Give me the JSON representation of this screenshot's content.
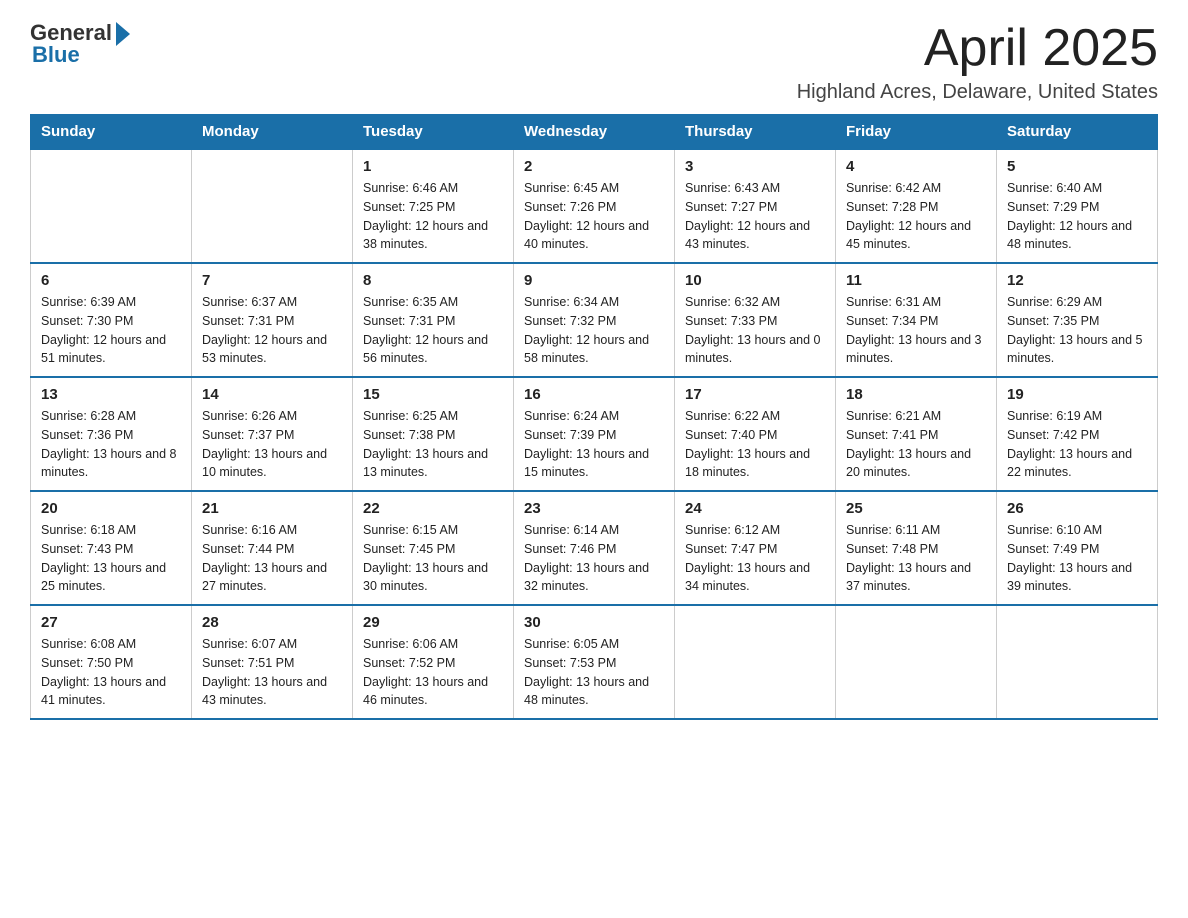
{
  "header": {
    "logo_general": "General",
    "logo_blue": "Blue",
    "month_title": "April 2025",
    "location": "Highland Acres, Delaware, United States"
  },
  "days_of_week": [
    "Sunday",
    "Monday",
    "Tuesday",
    "Wednesday",
    "Thursday",
    "Friday",
    "Saturday"
  ],
  "weeks": [
    [
      {
        "day": "",
        "info": ""
      },
      {
        "day": "",
        "info": ""
      },
      {
        "day": "1",
        "info": "Sunrise: 6:46 AM\nSunset: 7:25 PM\nDaylight: 12 hours\nand 38 minutes."
      },
      {
        "day": "2",
        "info": "Sunrise: 6:45 AM\nSunset: 7:26 PM\nDaylight: 12 hours\nand 40 minutes."
      },
      {
        "day": "3",
        "info": "Sunrise: 6:43 AM\nSunset: 7:27 PM\nDaylight: 12 hours\nand 43 minutes."
      },
      {
        "day": "4",
        "info": "Sunrise: 6:42 AM\nSunset: 7:28 PM\nDaylight: 12 hours\nand 45 minutes."
      },
      {
        "day": "5",
        "info": "Sunrise: 6:40 AM\nSunset: 7:29 PM\nDaylight: 12 hours\nand 48 minutes."
      }
    ],
    [
      {
        "day": "6",
        "info": "Sunrise: 6:39 AM\nSunset: 7:30 PM\nDaylight: 12 hours\nand 51 minutes."
      },
      {
        "day": "7",
        "info": "Sunrise: 6:37 AM\nSunset: 7:31 PM\nDaylight: 12 hours\nand 53 minutes."
      },
      {
        "day": "8",
        "info": "Sunrise: 6:35 AM\nSunset: 7:31 PM\nDaylight: 12 hours\nand 56 minutes."
      },
      {
        "day": "9",
        "info": "Sunrise: 6:34 AM\nSunset: 7:32 PM\nDaylight: 12 hours\nand 58 minutes."
      },
      {
        "day": "10",
        "info": "Sunrise: 6:32 AM\nSunset: 7:33 PM\nDaylight: 13 hours\nand 0 minutes."
      },
      {
        "day": "11",
        "info": "Sunrise: 6:31 AM\nSunset: 7:34 PM\nDaylight: 13 hours\nand 3 minutes."
      },
      {
        "day": "12",
        "info": "Sunrise: 6:29 AM\nSunset: 7:35 PM\nDaylight: 13 hours\nand 5 minutes."
      }
    ],
    [
      {
        "day": "13",
        "info": "Sunrise: 6:28 AM\nSunset: 7:36 PM\nDaylight: 13 hours\nand 8 minutes."
      },
      {
        "day": "14",
        "info": "Sunrise: 6:26 AM\nSunset: 7:37 PM\nDaylight: 13 hours\nand 10 minutes."
      },
      {
        "day": "15",
        "info": "Sunrise: 6:25 AM\nSunset: 7:38 PM\nDaylight: 13 hours\nand 13 minutes."
      },
      {
        "day": "16",
        "info": "Sunrise: 6:24 AM\nSunset: 7:39 PM\nDaylight: 13 hours\nand 15 minutes."
      },
      {
        "day": "17",
        "info": "Sunrise: 6:22 AM\nSunset: 7:40 PM\nDaylight: 13 hours\nand 18 minutes."
      },
      {
        "day": "18",
        "info": "Sunrise: 6:21 AM\nSunset: 7:41 PM\nDaylight: 13 hours\nand 20 minutes."
      },
      {
        "day": "19",
        "info": "Sunrise: 6:19 AM\nSunset: 7:42 PM\nDaylight: 13 hours\nand 22 minutes."
      }
    ],
    [
      {
        "day": "20",
        "info": "Sunrise: 6:18 AM\nSunset: 7:43 PM\nDaylight: 13 hours\nand 25 minutes."
      },
      {
        "day": "21",
        "info": "Sunrise: 6:16 AM\nSunset: 7:44 PM\nDaylight: 13 hours\nand 27 minutes."
      },
      {
        "day": "22",
        "info": "Sunrise: 6:15 AM\nSunset: 7:45 PM\nDaylight: 13 hours\nand 30 minutes."
      },
      {
        "day": "23",
        "info": "Sunrise: 6:14 AM\nSunset: 7:46 PM\nDaylight: 13 hours\nand 32 minutes."
      },
      {
        "day": "24",
        "info": "Sunrise: 6:12 AM\nSunset: 7:47 PM\nDaylight: 13 hours\nand 34 minutes."
      },
      {
        "day": "25",
        "info": "Sunrise: 6:11 AM\nSunset: 7:48 PM\nDaylight: 13 hours\nand 37 minutes."
      },
      {
        "day": "26",
        "info": "Sunrise: 6:10 AM\nSunset: 7:49 PM\nDaylight: 13 hours\nand 39 minutes."
      }
    ],
    [
      {
        "day": "27",
        "info": "Sunrise: 6:08 AM\nSunset: 7:50 PM\nDaylight: 13 hours\nand 41 minutes."
      },
      {
        "day": "28",
        "info": "Sunrise: 6:07 AM\nSunset: 7:51 PM\nDaylight: 13 hours\nand 43 minutes."
      },
      {
        "day": "29",
        "info": "Sunrise: 6:06 AM\nSunset: 7:52 PM\nDaylight: 13 hours\nand 46 minutes."
      },
      {
        "day": "30",
        "info": "Sunrise: 6:05 AM\nSunset: 7:53 PM\nDaylight: 13 hours\nand 48 minutes."
      },
      {
        "day": "",
        "info": ""
      },
      {
        "day": "",
        "info": ""
      },
      {
        "day": "",
        "info": ""
      }
    ]
  ]
}
